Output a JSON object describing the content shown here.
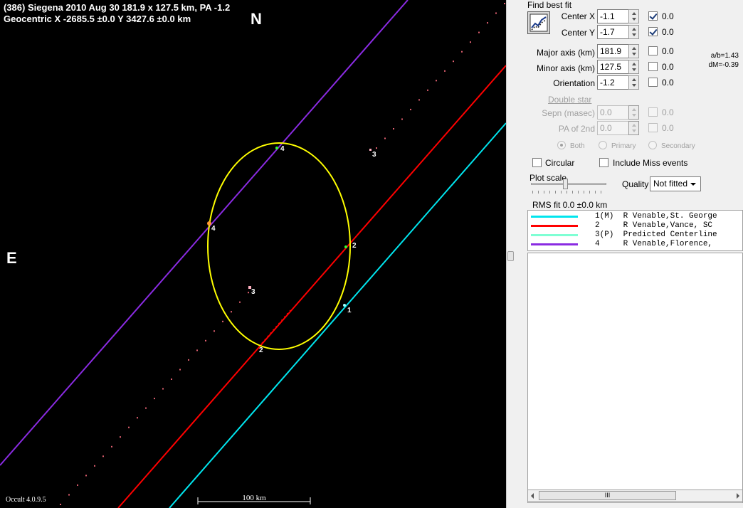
{
  "plot": {
    "title_line1": "(386) Siegena  2010 Aug 30   181.9 x 127.5 km,  PA -1.2",
    "title_line2": "Geocentric  X  -2685.5 ±0.0   Y 3427.6 ±0.0 km",
    "north_label": "N",
    "east_label": "E",
    "scale_label": "100 km",
    "version": "Occult 4.0.9.5",
    "chord_labels": {
      "c4_top": "4",
      "c3_top": "3",
      "c4_left": "4",
      "c2_right": "2",
      "c3_mid": "3",
      "c1": "1",
      "c2_bottom": "2"
    },
    "colors": {
      "chord1": "#00e5ee",
      "chord2": "#ff0000",
      "chord3": "#e06070",
      "chord4": "#8a2be2",
      "ellipse": "#ffff00"
    }
  },
  "panel": {
    "find_best_fit": "Find best fit",
    "center_x": {
      "label": "Center X",
      "value": "-1.1",
      "checked": true,
      "step": "0.0"
    },
    "center_y": {
      "label": "Center Y",
      "value": "-1.7",
      "checked": true,
      "step": "0.0"
    },
    "major_axis": {
      "label": "Major axis (km)",
      "value": "181.9",
      "checked": false,
      "step": "0.0"
    },
    "minor_axis": {
      "label": "Minor axis (km)",
      "value": "127.5",
      "checked": false,
      "step": "0.0"
    },
    "orientation": {
      "label": "Orientation",
      "value": "-1.2",
      "checked": false,
      "step": "0.0"
    },
    "ratio": "a/b=1.43",
    "dm": "dM=-0.39",
    "double_star": "Double star",
    "sepn": {
      "label": "Sepn (masec)",
      "value": "0.0",
      "step": "0.0"
    },
    "pa2nd": {
      "label": "PA of 2nd",
      "value": "0.0",
      "step": "0.0"
    },
    "radio_both": "Both",
    "radio_primary": "Primary",
    "radio_secondary": "Secondary",
    "circular": "Circular",
    "include_miss": "Include Miss events",
    "plot_scale": "Plot scale",
    "quality_label": "Quality",
    "quality_value": "Not fitted",
    "rms": "RMS fit  0.0 ±0.0 km",
    "hscroll_grip": "III",
    "legend": [
      {
        "text": "1(M)  R Venable,St. George",
        "color": "#00e5ee"
      },
      {
        "text": "2     R Venable,Vance, SC",
        "color": "#ff0000"
      },
      {
        "text": "3(P)  Predicted Centerline",
        "color": "#7fffd4"
      },
      {
        "text": "4     R Venable,Florence,",
        "color": "#8a2be2"
      }
    ]
  }
}
